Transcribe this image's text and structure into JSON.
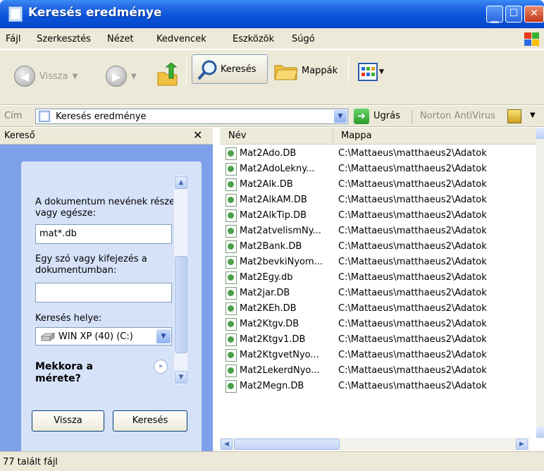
{
  "window": {
    "title": "Keresés eredménye"
  },
  "menu": [
    "Fájl",
    "Szerkesztés",
    "Nézet",
    "Kedvencek",
    "Eszközök",
    "Súgó"
  ],
  "toolbar": {
    "back": "Vissza",
    "search": "Keresés",
    "folders": "Mappák"
  },
  "address": {
    "label": "Cím",
    "value": "Keresés eredménye",
    "go": "Ugrás",
    "norton": "Norton AntiVirus"
  },
  "search_pane": {
    "title": "Kereső",
    "name_label": "A dokumentum nevének része vagy egésze:",
    "name_value": "mat*.db",
    "phrase_label": "Egy szó vagy kifejezés a dokumentumban:",
    "phrase_value": "",
    "location_label": "Keresés helye:",
    "location_value": "WIN XP (40) (C:)",
    "when_label": "Mekkora a mérete?",
    "back_button": "Vissza",
    "search_button": "Keresés"
  },
  "results": {
    "columns": [
      "Név",
      "Mappa"
    ],
    "rows": [
      {
        "name": "Mat2Ado.DB",
        "folder": "C:\\Mattaeus\\matthaeus2\\Adatok"
      },
      {
        "name": "Mat2AdoLekny...",
        "folder": "C:\\Mattaeus\\matthaeus2\\Adatok"
      },
      {
        "name": "Mat2Alk.DB",
        "folder": "C:\\Mattaeus\\matthaeus2\\Adatok"
      },
      {
        "name": "Mat2AlkAM.DB",
        "folder": "C:\\Mattaeus\\matthaeus2\\Adatok"
      },
      {
        "name": "Mat2AlkTip.DB",
        "folder": "C:\\Mattaeus\\matthaeus2\\Adatok"
      },
      {
        "name": "Mat2atvelismNy...",
        "folder": "C:\\Mattaeus\\matthaeus2\\Adatok"
      },
      {
        "name": "Mat2Bank.DB",
        "folder": "C:\\Mattaeus\\matthaeus2\\Adatok"
      },
      {
        "name": "Mat2bevkiNyom...",
        "folder": "C:\\Mattaeus\\matthaeus2\\Adatok"
      },
      {
        "name": "Mat2Egy.db",
        "folder": "C:\\Mattaeus\\matthaeus2\\Adatok"
      },
      {
        "name": "Mat2jar.DB",
        "folder": "C:\\Mattaeus\\matthaeus2\\Adatok"
      },
      {
        "name": "Mat2KEh.DB",
        "folder": "C:\\Mattaeus\\matthaeus2\\Adatok"
      },
      {
        "name": "Mat2Ktgv.DB",
        "folder": "C:\\Mattaeus\\matthaeus2\\Adatok"
      },
      {
        "name": "Mat2Ktgv1.DB",
        "folder": "C:\\Mattaeus\\matthaeus2\\Adatok"
      },
      {
        "name": "Mat2KtgvetNyo...",
        "folder": "C:\\Mattaeus\\matthaeus2\\Adatok"
      },
      {
        "name": "Mat2LekerdNyo...",
        "folder": "C:\\Mattaeus\\matthaeus2\\Adatok"
      },
      {
        "name": "Mat2Megn.DB",
        "folder": "C:\\Mattaeus\\matthaeus2\\Adatok"
      }
    ]
  },
  "status": {
    "text": "77 talált fájl"
  }
}
